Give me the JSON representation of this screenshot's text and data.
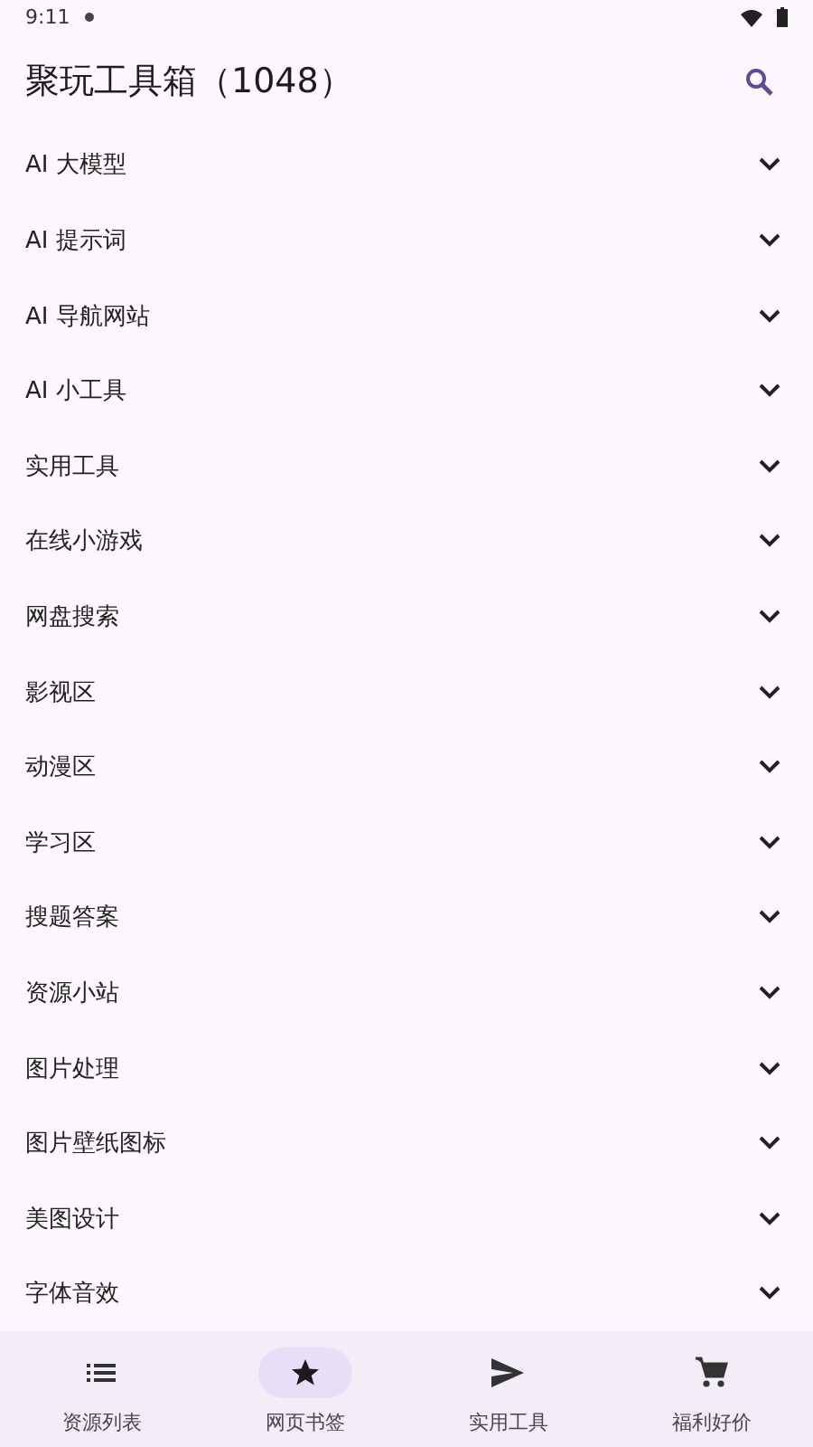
{
  "status_bar": {
    "time": "9:11"
  },
  "app_bar": {
    "title": "聚玩工具箱（1048）"
  },
  "categories": [
    {
      "label": "AI 大模型",
      "expanded": false
    },
    {
      "label": "AI 提示词",
      "expanded": false
    },
    {
      "label": "AI 导航网站",
      "expanded": false
    },
    {
      "label": "AI 小工具",
      "expanded": false
    },
    {
      "label": "实用工具",
      "expanded": false
    },
    {
      "label": "在线小游戏",
      "expanded": false
    },
    {
      "label": "网盘搜索",
      "expanded": false
    },
    {
      "label": "影视区",
      "expanded": false
    },
    {
      "label": "动漫区",
      "expanded": false
    },
    {
      "label": "学习区",
      "expanded": false
    },
    {
      "label": "搜题答案",
      "expanded": false
    },
    {
      "label": "资源小站",
      "expanded": false
    },
    {
      "label": "图片处理",
      "expanded": false
    },
    {
      "label": "图片壁纸图标",
      "expanded": false
    },
    {
      "label": "美图设计",
      "expanded": false
    },
    {
      "label": "字体音效",
      "expanded": false
    }
  ],
  "bottom_nav": [
    {
      "label": "资源列表",
      "kind": "list",
      "selected": false
    },
    {
      "label": "网页书签",
      "kind": "bookmarks",
      "selected": true
    },
    {
      "label": "实用工具",
      "kind": "tools",
      "selected": false
    },
    {
      "label": "福利好价",
      "kind": "deals",
      "selected": false
    }
  ]
}
